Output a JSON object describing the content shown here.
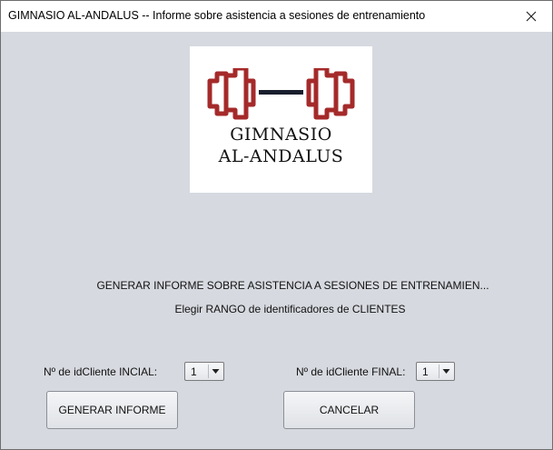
{
  "window": {
    "title": "GIMNASIO AL-ANDALUS -- Informe sobre asistencia a sesiones de entrenamiento"
  },
  "logo": {
    "line1": "GIMNASIO",
    "line2": "AL-ANDALUS",
    "icon": "dumbbell-icon",
    "plate_color": "#a52a2a",
    "bar_color": "#1a1f2e"
  },
  "main": {
    "heading": "GENERAR INFORME SOBRE ASISTENCIA A SESIONES DE ENTRENAMIEN...",
    "subheading": "Elegir RANGO de identificadores de CLIENTES"
  },
  "form": {
    "initial_label": "Nº de idCliente INCIAL:",
    "initial_value": "1",
    "final_label": "Nº de idCliente FINAL:",
    "final_value": "1"
  },
  "buttons": {
    "generate": "GENERAR INFORME",
    "cancel": "CANCELAR"
  }
}
